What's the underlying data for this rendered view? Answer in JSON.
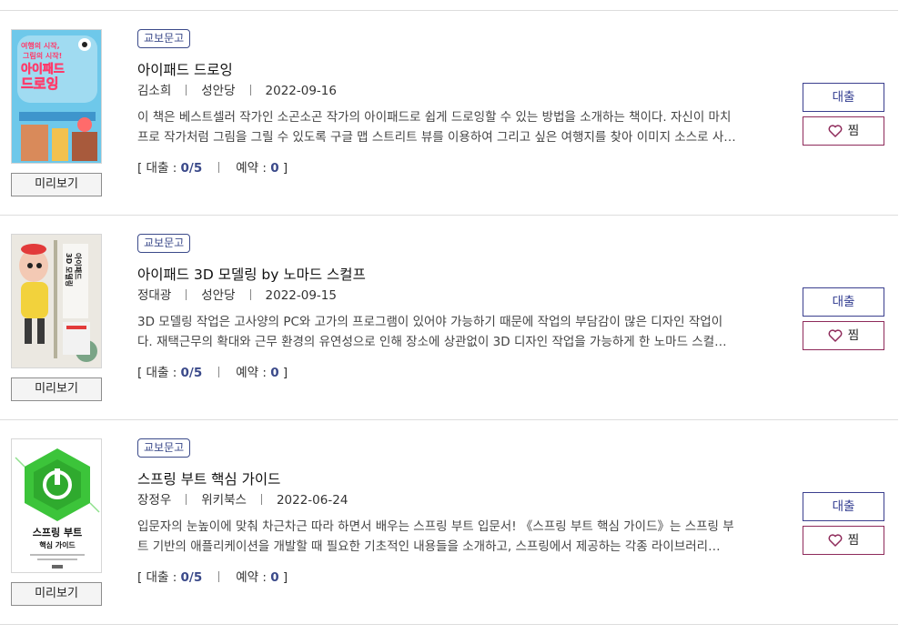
{
  "books": [
    {
      "badge": "교보문고",
      "title": "아이패드 드로잉",
      "author": "김소희",
      "publisher": "성안당",
      "date": "2022-09-16",
      "desc_line1": "이 책은 베스트셀러 작가인 소곤소곤 작가의 아이패드로 쉽게 드로잉할 수 있는 방법을 소개하는 책이다. 자신이 마치",
      "desc_line2": "프로 작가처럼 그림을 그릴 수 있도록 구글 맵 스트리트 뷰를 이용하여 그리고 싶은 여행지를 찾아 이미지 소스로 사…",
      "loan_label": "[ 대출 : ",
      "loan_value": "0/5",
      "reserve_label": "예약 : ",
      "reserve_value": "0",
      "close": " ]",
      "loan_button": "대출",
      "fav_button": "찜",
      "preview_button": "미리보기",
      "cover_text": [
        "여행의 시작,",
        "그림의 시작!",
        "아이패드",
        "드로잉"
      ]
    },
    {
      "badge": "교보문고",
      "title": "아이패드 3D 모델링 by 노마드 스컬프",
      "author": "정대광",
      "publisher": "성안당",
      "date": "2022-09-15",
      "desc_line1": "3D 모델링 작업은 고사양의 PC와 고가의 프로그램이 있어야 가능하기 때문에 작업의 부담감이 많은 디자인 작업이",
      "desc_line2": "다. 재택근무의 확대와 근무 환경의 유연성으로 인해 장소에 상관없이 3D 디자인 작업을 가능하게 한 노마드 스컬…",
      "loan_label": "[ 대출 : ",
      "loan_value": "0/5",
      "reserve_label": "예약 : ",
      "reserve_value": "0",
      "close": " ]",
      "loan_button": "대출",
      "fav_button": "찜",
      "preview_button": "미리보기",
      "cover_text": [
        "아이패드",
        "3D 모델링"
      ]
    },
    {
      "badge": "교보문고",
      "title": "스프링 부트 핵심 가이드",
      "author": "장정우",
      "publisher": "위키북스",
      "date": "2022-06-24",
      "desc_line1": "입문자의 눈높이에 맞춰 차근차근 따라 하면서 배우는 스프링 부트 입문서! 《스프링 부트 핵심 가이드》는 스프링 부",
      "desc_line2": "트 기반의 애플리케이션을 개발할 때 필요한 기초적인 내용들을 소개하고, 스프링에서 제공하는 각종 라이브러리…",
      "loan_label": "[ 대출 : ",
      "loan_value": "0/5",
      "reserve_label": "예약 : ",
      "reserve_value": "0",
      "close": " ]",
      "loan_button": "대출",
      "fav_button": "찜",
      "preview_button": "미리보기",
      "cover_text": [
        "스프링 부트",
        "핵심 가이드"
      ]
    }
  ],
  "colors": {
    "accent": "#3b4a8a",
    "fav_border": "#8e2a5a",
    "divider": "#dddddd"
  }
}
